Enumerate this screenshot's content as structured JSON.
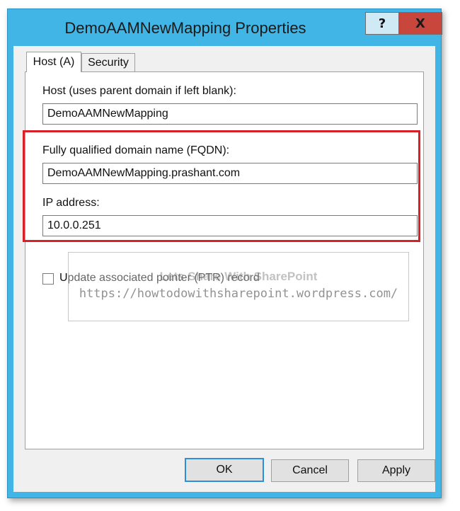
{
  "window": {
    "title": "DemoAAMNewMapping Properties",
    "help_label": "?",
    "close_label": "X"
  },
  "tabs": [
    {
      "label": "Host (A)"
    },
    {
      "label": "Security"
    }
  ],
  "form": {
    "host_label": "Host (uses parent domain if left blank):",
    "host_value": "DemoAAMNewMapping",
    "fqdn_label": "Fully qualified domain name (FQDN):",
    "fqdn_value": "DemoAAMNewMapping.prashant.com",
    "ip_label": "IP address:",
    "ip_value": "10.0.0.251",
    "ptr_label": "Update associated pointer (PTR) record"
  },
  "watermark": {
    "title": "Lets Share With SharePoint",
    "url": "https://howtodowithsharepoint.wordpress.com/"
  },
  "buttons": {
    "ok": "OK",
    "cancel": "Cancel",
    "apply": "Apply"
  },
  "colors": {
    "titlebar": "#41b6e6",
    "close": "#c9463d",
    "highlight": "#d72128"
  }
}
